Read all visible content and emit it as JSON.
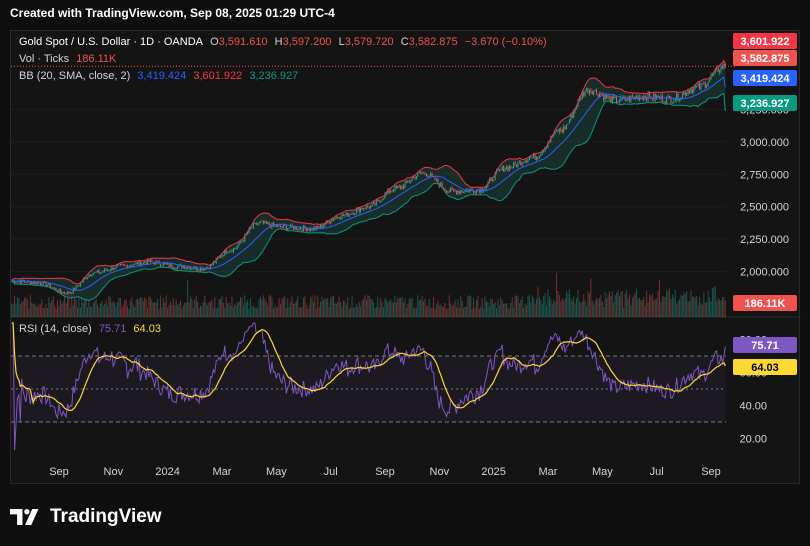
{
  "header": {
    "text": "Created with TradingView.com, Sep 08, 2025 01:29 UTC-4"
  },
  "legend": {
    "title": "Gold Spot / U.S. Dollar · 1D · OANDA",
    "o_label": "O",
    "o": "3,591.610",
    "h_label": "H",
    "h": "3,597.200",
    "l_label": "L",
    "l": "3,579.720",
    "c_label": "C",
    "c": "3,582.875",
    "change": "−3.670 (−0.10%)",
    "vol_label": "Vol · Ticks",
    "vol": "186.11K",
    "bb_label": "BB (20, SMA, close, 2)",
    "bb_basis": "3,419.424",
    "bb_upper": "3,601.922",
    "bb_lower": "3,236.927",
    "rsi_label": "RSI (14, close)",
    "rsi": "75.71",
    "rsi_ma": "64.03"
  },
  "footer": {
    "brand": "TradingView"
  },
  "colors": {
    "candle_up": "#26a69a",
    "candle_down": "#ef5350",
    "bb_upper": "#f23645",
    "bb_basis": "#2962ff",
    "bb_lower": "#089981",
    "bb_fill": "#1f5c52",
    "rsi": "#7e57c2",
    "rsi_ma": "#fdd835",
    "axis_text": "#d1d4dc",
    "background": "#141414"
  },
  "chart_data": [
    {
      "type": "candlestick",
      "title": "Gold Spot / U.S. Dollar · 1D · OANDA",
      "x_ticks": [
        "Sep",
        "Nov",
        "2024",
        "Mar",
        "May",
        "Jul",
        "Sep",
        "Nov",
        "2025",
        "Mar",
        "May",
        "Jul",
        "Sep"
      ],
      "y_ticks": [
        "1,750.000",
        "2,000.000",
        "2,250.000",
        "2,500.000",
        "2,750.000",
        "3,000.000",
        "3,250.000"
      ],
      "ylim": [
        1650,
        3700
      ],
      "price_anchors": [
        {
          "date": "Aug 2023",
          "close": 1930
        },
        {
          "date": "Sep 2023",
          "close": 1915
        },
        {
          "date": "Oct 2023",
          "close": 1835
        },
        {
          "date": "Oct 2023",
          "close": 1990
        },
        {
          "date": "Nov 2023",
          "close": 2040
        },
        {
          "date": "Dec 2023",
          "close": 2075
        },
        {
          "date": "Jan 2024",
          "close": 2040
        },
        {
          "date": "Feb 2024",
          "close": 2025
        },
        {
          "date": "Mar 2024",
          "close": 2170
        },
        {
          "date": "Apr 2024",
          "close": 2370
        },
        {
          "date": "May 2024",
          "close": 2340
        },
        {
          "date": "Jun 2024",
          "close": 2330
        },
        {
          "date": "Jul 2024",
          "close": 2430
        },
        {
          "date": "Aug 2024",
          "close": 2500
        },
        {
          "date": "Sep 2024",
          "close": 2640
        },
        {
          "date": "Oct 2024",
          "close": 2760
        },
        {
          "date": "Nov 2024",
          "close": 2620
        },
        {
          "date": "Dec 2024",
          "close": 2630
        },
        {
          "date": "Jan 2025",
          "close": 2800
        },
        {
          "date": "Feb 2025",
          "close": 2880
        },
        {
          "date": "Mar 2025",
          "close": 3090
        },
        {
          "date": "Apr 2025",
          "close": 3400
        },
        {
          "date": "May 2025",
          "close": 3320
        },
        {
          "date": "Jun 2025",
          "close": 3350
        },
        {
          "date": "Jul 2025",
          "close": 3330
        },
        {
          "date": "Aug 2025",
          "close": 3420
        },
        {
          "date": "Sep 08, 2025",
          "close": 3583
        }
      ],
      "last": {
        "open": 3591.61,
        "high": 3597.2,
        "low": 3579.72,
        "close": 3582.875
      },
      "series": [
        {
          "name": "BB upper",
          "last": 3601.922
        },
        {
          "name": "BB basis",
          "last": 3419.424
        },
        {
          "name": "BB lower",
          "last": 3236.927
        }
      ],
      "price_labels": [
        "3,601.922",
        "3,582.875",
        "3,419.424",
        "3,236.927"
      ]
    },
    {
      "type": "bar",
      "title": "Vol · Ticks",
      "last": 186110,
      "label": "186.11K"
    },
    {
      "type": "line",
      "title": "RSI (14, close)",
      "y_ticks": [
        "20.00",
        "40.00",
        "60.00",
        "80.00"
      ],
      "ylim": [
        10,
        90
      ],
      "bands": [
        30,
        70
      ],
      "series": [
        {
          "name": "RSI",
          "last": 75.71
        },
        {
          "name": "RSI MA",
          "last": 64.03
        }
      ],
      "value_labels": [
        "75.71",
        "64.03"
      ]
    }
  ]
}
